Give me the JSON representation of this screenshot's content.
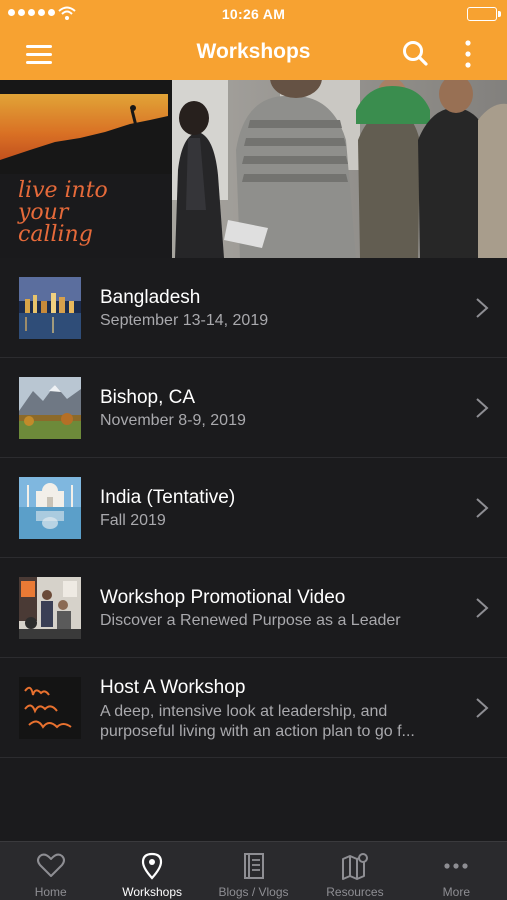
{
  "status_bar": {
    "time": "10:26 AM"
  },
  "header": {
    "title": "Workshops"
  },
  "hero": {
    "poster_text": "live into your calling"
  },
  "workshops": [
    {
      "title": "Bangladesh",
      "subtitle": "September 13-14, 2019",
      "thumb": "bangladesh-city-night"
    },
    {
      "title": "Bishop, CA",
      "subtitle": "November 8-9, 2019",
      "thumb": "mountain-landscape"
    },
    {
      "title": "India (Tentative)",
      "subtitle": "Fall 2019",
      "thumb": "taj-mahal"
    },
    {
      "title": "Workshop Promotional Video",
      "subtitle": "Discover a Renewed Purpose as a Leader",
      "thumb": "workshop-group"
    },
    {
      "title": "Host A Workshop",
      "description_line1": "A deep, intensive look at leadership, and",
      "description_line2": "purposeful living with an action plan to go f...",
      "thumb": "live-into-your-calling"
    }
  ],
  "tabs": [
    {
      "label": "Home",
      "icon": "heart-icon"
    },
    {
      "label": "Workshops",
      "icon": "map-pin-icon",
      "active": true
    },
    {
      "label": "Blogs / Vlogs",
      "icon": "book-icon"
    },
    {
      "label": "Resources",
      "icon": "map-icon"
    },
    {
      "label": "More",
      "icon": "ellipsis-icon"
    }
  ],
  "colors": {
    "accent": "#f7a231",
    "background": "#1b1b1d",
    "tabbar": "#2a2a2d",
    "subtitle": "#a9a9ad"
  }
}
